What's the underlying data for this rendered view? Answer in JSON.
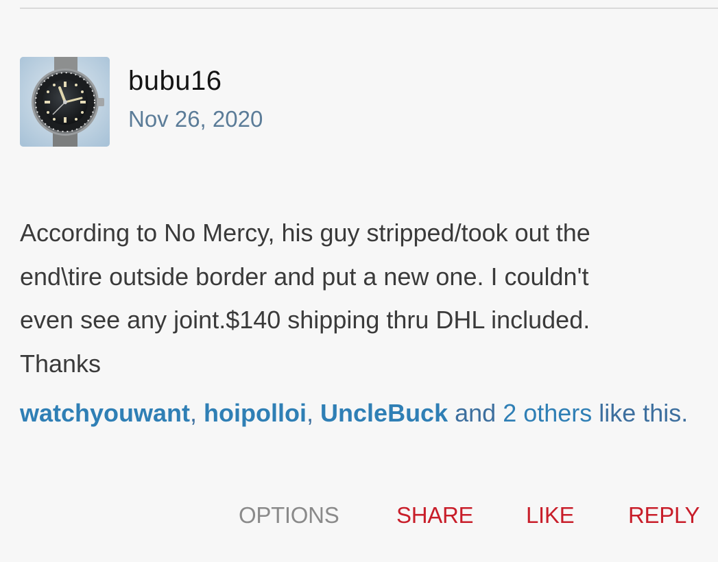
{
  "post": {
    "author": "bubu16",
    "date": "Nov 26, 2020",
    "avatar_icon": "watch-photo-avatar",
    "message_lines": [
      "According to No Mercy, his guy stripped/took out the",
      "end\\tire outside border and put a new one. I couldn't",
      "even see any joint.$140 shipping thru DHL included.",
      "Thanks"
    ]
  },
  "likes": {
    "users": [
      "watchyouwant",
      "hoipolloi",
      "UncleBuck"
    ],
    "sep1": ", ",
    "sep2": ", ",
    "and_text": " and ",
    "others_text": "2 others",
    "tail_text": " like this."
  },
  "actions": {
    "options": "OPTIONS",
    "share": "SHARE",
    "like": "LIKE",
    "reply": "REPLY"
  },
  "colors": {
    "background": "#f7f7f7",
    "date": "#5b7c98",
    "link": "#2f7fb5",
    "action_red": "#c81e2a",
    "action_gray": "#8a8a8a"
  }
}
